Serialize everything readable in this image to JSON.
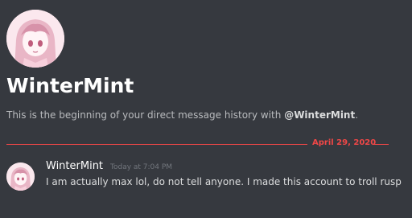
{
  "channel": {
    "username": "WinterMint",
    "intro_prefix": "This is the beginning of your direct message history with ",
    "intro_mention": "@WinterMint",
    "intro_suffix": "."
  },
  "divider": {
    "date": "April 29, 2020",
    "color": "#f04747"
  },
  "message": {
    "author": "WinterMint",
    "timestamp": "Today at 7:04 PM",
    "text": "I am actually max lol, do not tell anyone. I made this account to troll rusp"
  },
  "colors": {
    "background": "#36393f",
    "avatar_bg": "#f3d9e2"
  },
  "icons": {
    "avatar": "anime-girl-avatar"
  }
}
